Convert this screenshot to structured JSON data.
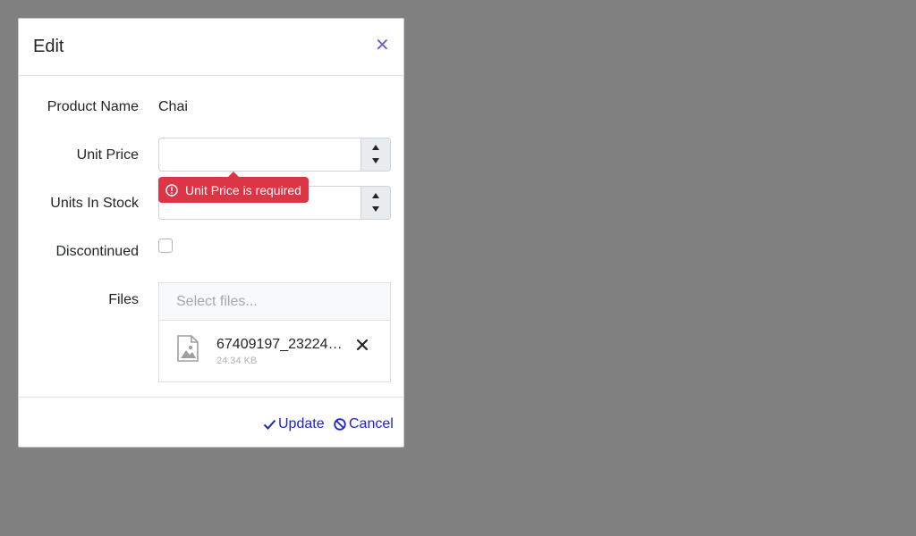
{
  "dialog": {
    "title": "Edit",
    "close_icon": "close-icon"
  },
  "form": {
    "product_name": {
      "label": "Product Name",
      "value": "Chai"
    },
    "unit_price": {
      "label": "Unit Price",
      "value": "",
      "validation": "Unit Price is required"
    },
    "units_in_stock": {
      "label": "Units In Stock",
      "value": ""
    },
    "discontinued": {
      "label": "Discontinued",
      "checked": false
    },
    "files": {
      "label": "Files",
      "placeholder": "Select files...",
      "items": [
        {
          "name": "67409197_232246…",
          "size": "24.34 KB",
          "icon": "image-file-icon"
        }
      ]
    }
  },
  "footer": {
    "update_label": "Update",
    "cancel_label": "Cancel"
  },
  "colors": {
    "overlay": "#808080",
    "error": "#dc3545",
    "link": "#1e24c8",
    "close": "#6c63d6"
  }
}
